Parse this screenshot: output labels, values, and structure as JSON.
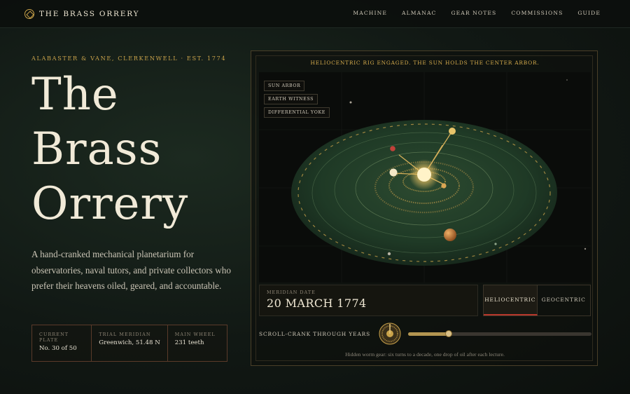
{
  "nav": {
    "brand": "THE BRASS ORRERY",
    "links": [
      "MACHINE",
      "ALMANAC",
      "GEAR NOTES",
      "COMMISSIONS",
      "GUIDE"
    ]
  },
  "hero": {
    "eyebrow": "ALABASTER & VANE, CLERKENWELL · EST. 1774",
    "title_lines": [
      "The",
      "Brass",
      "Orrery"
    ],
    "lede": "A hand-cranked mechanical planetarium for observatories, naval tutors, and private collectors who prefer their heavens oiled, geared, and accountable."
  },
  "stats": [
    {
      "label": "CURRENT PLATE",
      "value": "No. 30 of 50"
    },
    {
      "label": "TRIAL MERIDIAN",
      "value": "Greenwich, 51.48 N"
    },
    {
      "label": "MAIN WHEEL",
      "value": "231 teeth"
    }
  ],
  "panel": {
    "banner": "HELIOCENTRIC RIG ENGAGED. THE SUN HOLDS THE CENTER ARBOR.",
    "tags": [
      "SUN ARBOR",
      "EARTH WITNESS",
      "DIFFERENTIAL YOKE"
    ],
    "meridian_label": "MERIDIAN DATE",
    "meridian_value": "20 MARCH 1774",
    "modes": [
      "HELIOCENTRIC",
      "GEOCENTRIC"
    ],
    "active_mode": "HELIOCENTRIC",
    "crank_label": "SCROLL-CRANK THROUGH YEARS",
    "slider_value": 0.22,
    "footnote": "Hidden worm gear: six turns to a decade, one drop of oil after each lecture."
  },
  "colors": {
    "brass": "#c9a24a",
    "felt": "#1f3a26",
    "active_underline": "#b8382c"
  }
}
